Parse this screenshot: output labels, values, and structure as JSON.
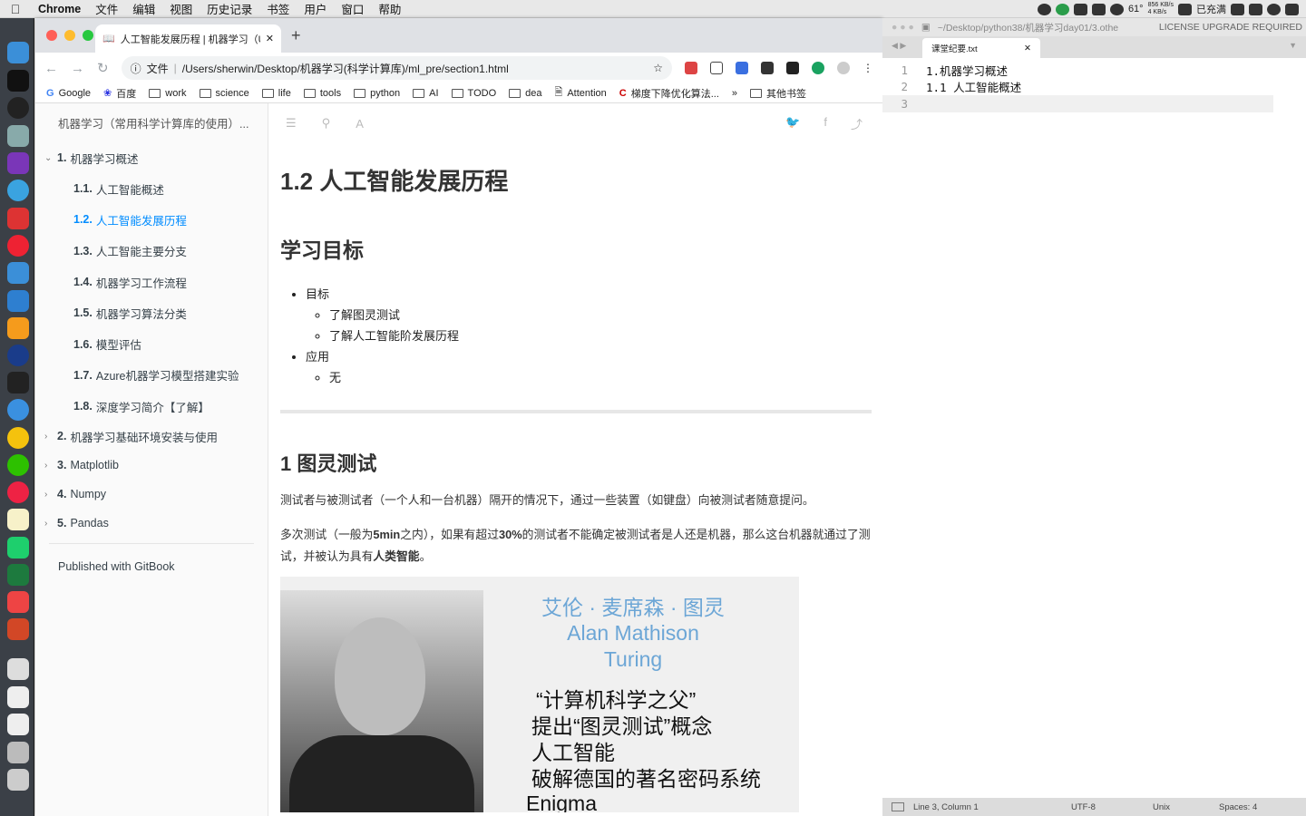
{
  "menubar": {
    "app": "Chrome",
    "items": [
      "文件",
      "编辑",
      "视图",
      "历史记录",
      "书签",
      "用户",
      "窗口",
      "帮助"
    ],
    "temp": "61°",
    "net_up": "856 KB/s",
    "net_down": "4 KB/s",
    "battery": "已充满"
  },
  "browser": {
    "tab_title": "人工智能发展历程 | 机器学习（U",
    "url_scheme": "文件",
    "url": "/Users/sherwin/Desktop/机器学习(科学计算库)/ml_pre/section1.html",
    "bookmarks": [
      "Google",
      "百度",
      "work",
      "science",
      "life",
      "tools",
      "python",
      "AI",
      "TODO",
      "dea",
      "Attention",
      "梯度下降优化算法...",
      "»",
      "其他书签"
    ]
  },
  "sidebar": {
    "header": "机器学习（常用科学计算库的使用）...",
    "items": [
      {
        "num": "1.",
        "label": "机器学习概述"
      },
      {
        "num": "1.1.",
        "label": "人工智能概述"
      },
      {
        "num": "1.2.",
        "label": "人工智能发展历程"
      },
      {
        "num": "1.3.",
        "label": "人工智能主要分支"
      },
      {
        "num": "1.4.",
        "label": "机器学习工作流程"
      },
      {
        "num": "1.5.",
        "label": "机器学习算法分类"
      },
      {
        "num": "1.6.",
        "label": "模型评估"
      },
      {
        "num": "1.7.",
        "label": "Azure机器学习模型搭建实验"
      },
      {
        "num": "1.8.",
        "label": "深度学习简介【了解】"
      },
      {
        "num": "2.",
        "label": "机器学习基础环境安装与使用"
      },
      {
        "num": "3.",
        "label": "Matplotlib"
      },
      {
        "num": "4.",
        "label": "Numpy"
      },
      {
        "num": "5.",
        "label": "Pandas"
      }
    ],
    "published": "Published with GitBook"
  },
  "page": {
    "title": "1.2 人工智能发展历程",
    "goals_heading": "学习目标",
    "goal": "目标",
    "goal_items": [
      "了解图灵测试",
      "了解人工智能阶发展历程"
    ],
    "apply": "应用",
    "apply_items": [
      "无"
    ],
    "section": "1 图灵测试",
    "p1": "测试者与被测试者（一个人和一台机器）隔开的情况下，通过一些装置（如键盘）向被测试者随意提问。",
    "p2a": "多次测试（一般为",
    "p2b": "5min",
    "p2c": "之内），如果有超过",
    "p2d": "30%",
    "p2e": "的测试者不能确定被测试者是人还是机器，那么这台机器就通过了测试，并被认为具有",
    "p2f": "人类智能",
    "p2g": "。",
    "img_name_cn": "艾伦 · 麦席森 · 图灵",
    "img_name_en1": "Alan Mathison",
    "img_name_en2": "Turing",
    "img_facts": [
      "“计算机科学之父”",
      "提出“图灵测试”概念",
      "人工智能",
      "破解德国的著名密码系统",
      "Enigma"
    ]
  },
  "editor": {
    "path": "~/Desktop/python38/机器学习day01/3.othe",
    "license": "LICENSE UPGRADE REQUIRED",
    "tab": "课堂纪要.txt",
    "lines": [
      {
        "n": "1",
        "t": "1.机器学习概述"
      },
      {
        "n": "2",
        "t": "1.1 人工智能概述"
      },
      {
        "n": "3",
        "t": ""
      }
    ],
    "status": {
      "pos": "Line 3, Column 1",
      "enc": "UTF-8",
      "eol": "Unix",
      "spaces": "Spaces: 4"
    }
  }
}
